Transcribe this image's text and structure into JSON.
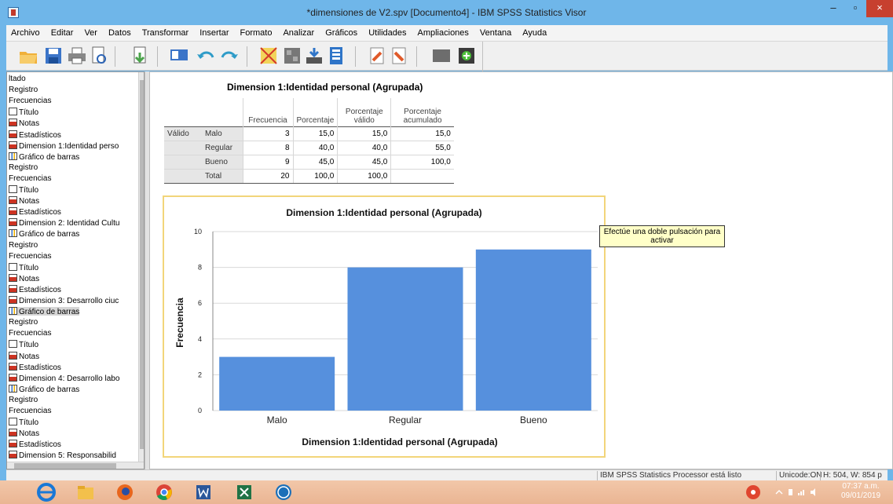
{
  "window": {
    "title": "*dimensiones de V2.spv [Documento4] - IBM SPSS Statistics Visor",
    "minimize": "–",
    "maximize": "▫",
    "close": "×"
  },
  "menu": [
    "Archivo",
    "Editar",
    "Ver",
    "Datos",
    "Transformar",
    "Insertar",
    "Formato",
    "Analizar",
    "Gráficos",
    "Utilidades",
    "Ampliaciones",
    "Ventana",
    "Ayuda"
  ],
  "toolbar": {
    "icons": [
      "open-folder-icon",
      "save-icon",
      "print-icon",
      "print-preview-icon",
      "export-icon",
      "goto-data-icon",
      "undo-icon",
      "redo-icon",
      "goto-case-icon",
      "variables-icon",
      "designate-window-icon",
      "split-icon",
      "promote-icon",
      "demote-icon",
      "collapse-icon",
      "expand-icon"
    ]
  },
  "outline": [
    {
      "label": "ltado",
      "icon": "none"
    },
    {
      "label": "Registro",
      "icon": "none"
    },
    {
      "label": "Frecuencias",
      "icon": "none"
    },
    {
      "label": "Título",
      "icon": "doc"
    },
    {
      "label": "Notas",
      "icon": "red"
    },
    {
      "label": "Estadísticos",
      "icon": "red"
    },
    {
      "label": "Dimension 1:Identidad perso",
      "icon": "red"
    },
    {
      "label": "Gráfico de barras",
      "icon": "chart"
    },
    {
      "label": "Registro",
      "icon": "none"
    },
    {
      "label": "Frecuencias",
      "icon": "none"
    },
    {
      "label": "Título",
      "icon": "doc"
    },
    {
      "label": "Notas",
      "icon": "red"
    },
    {
      "label": "Estadísticos",
      "icon": "red"
    },
    {
      "label": "Dimension 2: Identidad Cultu",
      "icon": "red"
    },
    {
      "label": "Gráfico de barras",
      "icon": "chart"
    },
    {
      "label": "Registro",
      "icon": "none"
    },
    {
      "label": "Frecuencias",
      "icon": "none"
    },
    {
      "label": "Título",
      "icon": "doc"
    },
    {
      "label": "Notas",
      "icon": "red"
    },
    {
      "label": "Estadísticos",
      "icon": "red"
    },
    {
      "label": "Dimension 3: Desarrollo ciuc",
      "icon": "red"
    },
    {
      "label": "Gráfico de barras",
      "icon": "chart",
      "selected": true
    },
    {
      "label": "Registro",
      "icon": "none"
    },
    {
      "label": "Frecuencias",
      "icon": "none"
    },
    {
      "label": "Título",
      "icon": "doc"
    },
    {
      "label": "Notas",
      "icon": "red"
    },
    {
      "label": "Estadísticos",
      "icon": "red"
    },
    {
      "label": "Dimension 4: Desarrollo labo",
      "icon": "red"
    },
    {
      "label": "Gráfico de barras",
      "icon": "chart"
    },
    {
      "label": "Registro",
      "icon": "none"
    },
    {
      "label": "Frecuencias",
      "icon": "none"
    },
    {
      "label": "Título",
      "icon": "doc"
    },
    {
      "label": "Notas",
      "icon": "red"
    },
    {
      "label": "Estadísticos",
      "icon": "red"
    },
    {
      "label": "Dimension 5: Responsabilid",
      "icon": "red"
    }
  ],
  "freq_table": {
    "title": "Dimension 1:Identidad personal (Agrupada)",
    "headers": {
      "frecuencia": "Frecuencia",
      "porcentaje": "Porcentaje",
      "valido_1": "Porcentaje",
      "valido_2": "válido",
      "acum_1": "Porcentaje",
      "acum_2": "acumulado"
    },
    "group_label": "Válido",
    "rows": [
      {
        "cat": "Malo",
        "freq": "3",
        "pct": "15,0",
        "valid": "15,0",
        "cum": "15,0"
      },
      {
        "cat": "Regular",
        "freq": "8",
        "pct": "40,0",
        "valid": "40,0",
        "cum": "55,0"
      },
      {
        "cat": "Bueno",
        "freq": "9",
        "pct": "45,0",
        "valid": "45,0",
        "cum": "100,0"
      },
      {
        "cat": "Total",
        "freq": "20",
        "pct": "100,0",
        "valid": "100,0",
        "cum": ""
      }
    ]
  },
  "chart_data": {
    "type": "bar",
    "title": "Dimension 1:Identidad personal (Agrupada)",
    "categories": [
      "Malo",
      "Regular",
      "Bueno"
    ],
    "values": [
      3,
      8,
      9
    ],
    "xlabel": "Dimension 1:Identidad personal (Agrupada)",
    "ylabel": "Frecuencia",
    "ylim": [
      0,
      10
    ],
    "yticks": [
      0,
      2,
      4,
      6,
      8,
      10
    ],
    "grid": true,
    "bar_color": "#5690dd"
  },
  "tooltip": {
    "line1": "Efectúe una doble pulsación para",
    "line2": "activar"
  },
  "status": {
    "processor": "IBM SPSS Statistics Processor está listo",
    "unicode": "Unicode:ON",
    "dims": "H: 504, W: 854 p"
  },
  "taskbar": {
    "apps": [
      "ie-icon",
      "file-explorer-icon",
      "firefox-icon",
      "chrome-icon",
      "word-icon",
      "excel-icon",
      "spss-icon"
    ],
    "time": "07:37 a.m.",
    "date": "09/01/2019"
  }
}
